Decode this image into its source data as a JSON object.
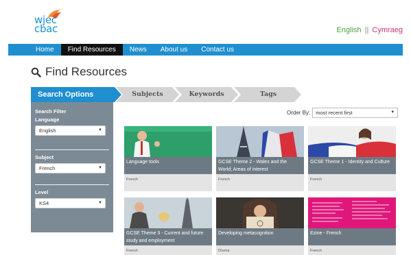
{
  "header": {
    "logo_line1": "wjec",
    "logo_line2": "cbac",
    "lang_english": "English",
    "lang_separator": "||",
    "lang_welsh": "Cymraeg"
  },
  "nav": {
    "items": [
      {
        "label": "Home"
      },
      {
        "label": "Find Resources"
      },
      {
        "label": "News"
      },
      {
        "label": "About us"
      },
      {
        "label": "Contact us"
      }
    ],
    "active": "Find Resources"
  },
  "page_title": "Find Resources",
  "steps": {
    "search_options": "Search Options",
    "subjects": "Subjects",
    "keywords": "Keywords",
    "tags": "Tags"
  },
  "sidebar": {
    "heading": "Search Filter",
    "language_label": "Language",
    "language_value": "English",
    "subject_label": "Subject",
    "subject_value": "French",
    "level_label": "Level",
    "level_value": "KS4"
  },
  "order_by": {
    "label": "Order By:",
    "value": "most recent first"
  },
  "cards": [
    {
      "title": "Language tools",
      "subject": "French"
    },
    {
      "title": "GCSE Theme 2 - Wales and the World; Areas of interest",
      "subject": "French"
    },
    {
      "title": "GCSE Theme 1 - Identity and Culture",
      "subject": "French"
    },
    {
      "title": "GCSE Theme 3 - Current and future study and employment",
      "subject": "French"
    },
    {
      "title": "Developing metacognition",
      "subject": "Drama"
    },
    {
      "title": "Ezine - French",
      "subject": "French"
    }
  ],
  "colors": {
    "brand_blue": "#1f8fd0",
    "nav_active": "#111111",
    "sidebar_gray": "#7c8a95",
    "english_green": "#4aa33a",
    "welsh_pink": "#c8326f"
  }
}
